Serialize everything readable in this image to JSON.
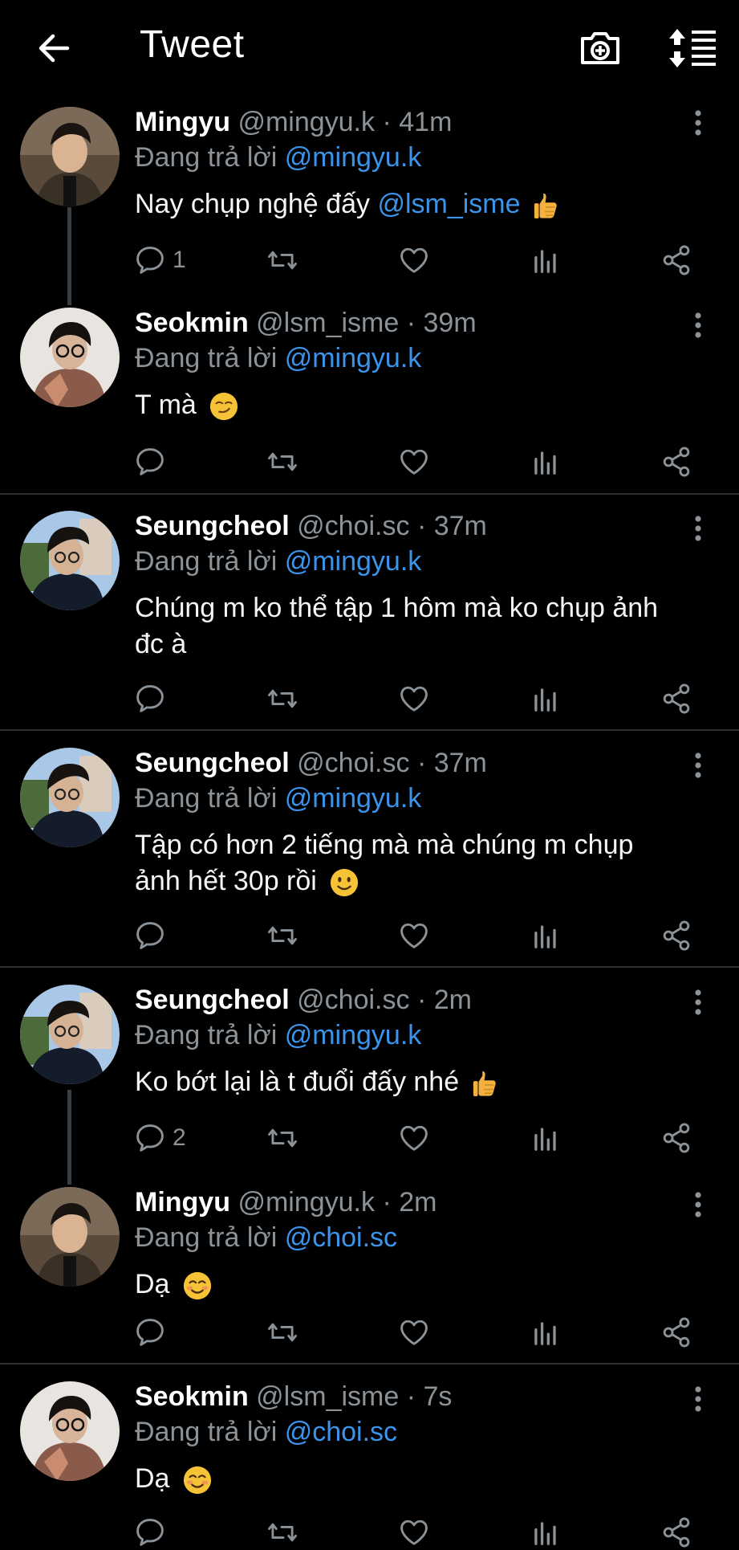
{
  "header": {
    "title": "Tweet"
  },
  "reply_prefix": "Đang trả lời",
  "tweets": [
    {
      "name": "Mingyu",
      "handle": "@mingyu.k",
      "time": "41m",
      "reply_to": "@mingyu.k",
      "text": "Nay chụp nghệ đấy",
      "mention": "@lsm_isme",
      "emoji": "👍",
      "replies": "1"
    },
    {
      "name": "Seokmin",
      "handle": "@lsm_isme",
      "time": "39m",
      "reply_to": "@mingyu.k",
      "text": "T mà",
      "emoji": "😏"
    },
    {
      "name": "Seungcheol",
      "handle": "@choi.sc",
      "time": "37m",
      "reply_to": "@mingyu.k",
      "text_line1": "Chúng m ko thể tập 1 hôm mà ko chụp ảnh",
      "text_line2": "đc à"
    },
    {
      "name": "Seungcheol",
      "handle": "@choi.sc",
      "time": "37m",
      "reply_to": "@mingyu.k",
      "text_line1": "Tập có hơn 2 tiếng mà mà chúng m chụp",
      "text_line2": "ảnh hết 30p rồi",
      "emoji": "🙂"
    },
    {
      "name": "Seungcheol",
      "handle": "@choi.sc",
      "time": "2m",
      "reply_to": "@mingyu.k",
      "text": "Ko bớt lại là t đuổi đấy nhé",
      "emoji": "👍",
      "replies": "2"
    },
    {
      "name": "Mingyu",
      "handle": "@mingyu.k",
      "time": "2m",
      "reply_to": "@choi.sc",
      "text": "Dạ",
      "emoji": "😊"
    },
    {
      "name": "Seokmin",
      "handle": "@lsm_isme",
      "time": "7s",
      "reply_to": "@choi.sc",
      "text": "Dạ",
      "emoji": "😊"
    }
  ],
  "icons": {
    "back": "arrow-left-icon",
    "camera": "camera-add-icon",
    "sort": "sort-list-icon",
    "reply": "speech-bubble-icon",
    "retweet": "retweet-icon",
    "like": "heart-icon",
    "stats": "bar-stats-icon",
    "share": "share-icon",
    "more": "vertical-dots-icon"
  },
  "colors": {
    "background": "#000000",
    "text": "#f3f5f7",
    "muted": "#8b9298",
    "link": "#3b94ea",
    "thumb": "#f4b13e"
  }
}
